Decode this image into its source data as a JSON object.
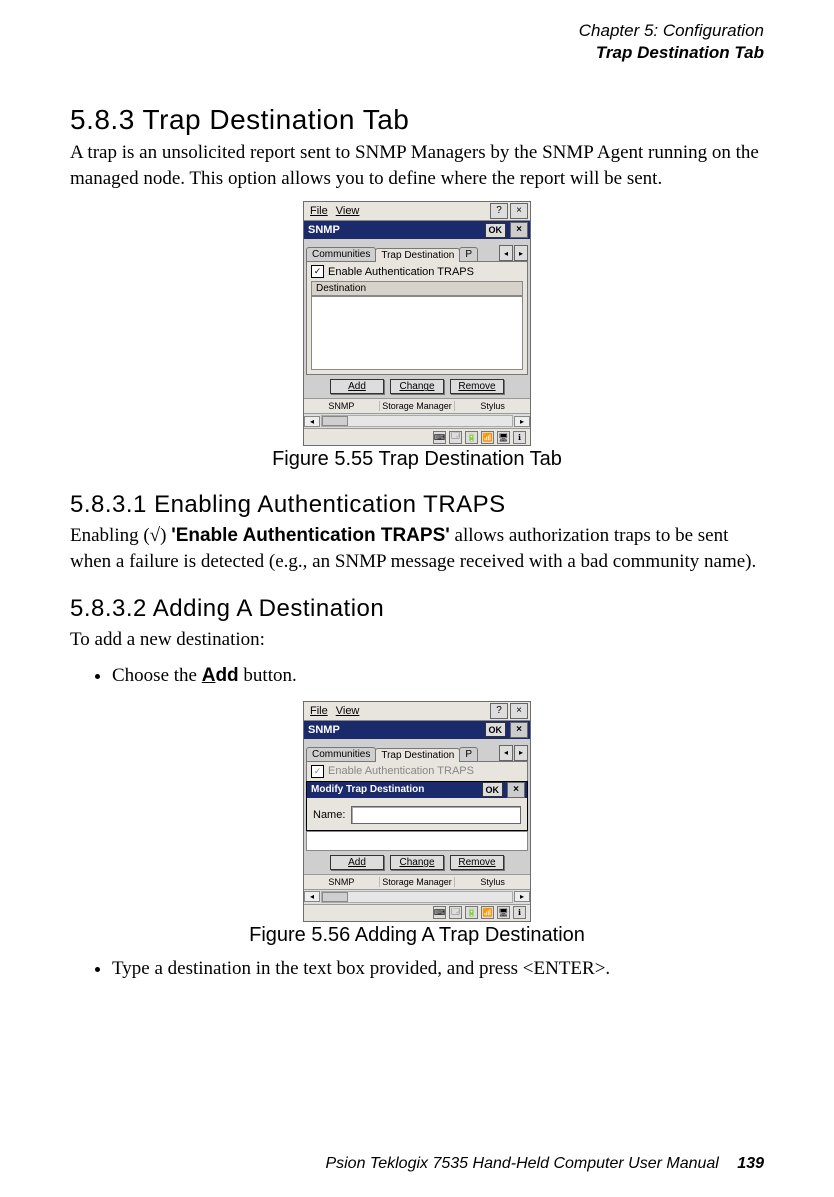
{
  "header": {
    "line1": "Chapter 5: Configuration",
    "line2": "Trap Destination Tab"
  },
  "section": {
    "num_title": "5.8.3  Trap Destination Tab",
    "para": "A trap is an unsolicited report sent to SNMP Managers by the SNMP Agent running on the managed node. This option allows you to define where the report will be sent."
  },
  "figure55": {
    "caption": "Figure 5.55 Trap Destination Tab",
    "menu_file": "File",
    "menu_view": "View",
    "help_q": "?",
    "close_x": "×",
    "title": "SNMP",
    "ok": "OK",
    "tab_communities": "Communities",
    "tab_trap": "Trap Destination",
    "tab_p": "P",
    "arrow_l": "◂",
    "arrow_r": "▸",
    "check_mark": "✓",
    "check_label": "Enable Authentication TRAPS",
    "list_header": "Destination",
    "btn_add": "Add",
    "btn_change": "Change",
    "btn_remove": "Remove",
    "status1": "SNMP",
    "status2": "Storage Manager",
    "status3": "Stylus",
    "scroll_l": "◂",
    "scroll_r": "▸"
  },
  "sub1": {
    "num_title": "5.8.3.1    Enabling Authentication TRAPS",
    "para_pre": "Enabling (√) ",
    "para_bold": "'Enable Authentication TRAPS'",
    "para_post": " allows authorization traps to be sent when a failure is detected (e.g., an SNMP message received with a bad community name)."
  },
  "sub2": {
    "num_title": "5.8.3.2    Adding A Destination",
    "intro": "To add a new destination:",
    "bullet1_pre": "Choose the ",
    "bullet1_btn_u": "A",
    "bullet1_btn_rest": "dd",
    "bullet1_post": " button.",
    "bullet2": "Type a destination in the text box provided, and press <ENTER>."
  },
  "figure56": {
    "caption": "Figure 5.56 Adding A Trap Destination",
    "menu_file": "File",
    "menu_view": "View",
    "help_q": "?",
    "close_x": "×",
    "title": "SNMP",
    "ok": "OK",
    "tab_communities": "Communities",
    "tab_trap": "Trap Destination",
    "tab_p": "P",
    "arrow_l": "◂",
    "arrow_r": "▸",
    "check_mark": "✓",
    "check_label": "Enable Authentication TRAPS",
    "modal_title": "Modify Trap Destination",
    "modal_ok": "OK",
    "modal_close": "×",
    "name_label": "Name:",
    "btn_add": "Add",
    "btn_change": "Change",
    "btn_remove": "Remove",
    "status1": "SNMP",
    "status2": "Storage Manager",
    "status3": "Stylus",
    "scroll_l": "◂",
    "scroll_r": "▸"
  },
  "footer": {
    "text": "Psion Teklogix 7535 Hand-Held Computer User Manual",
    "page": "139"
  }
}
